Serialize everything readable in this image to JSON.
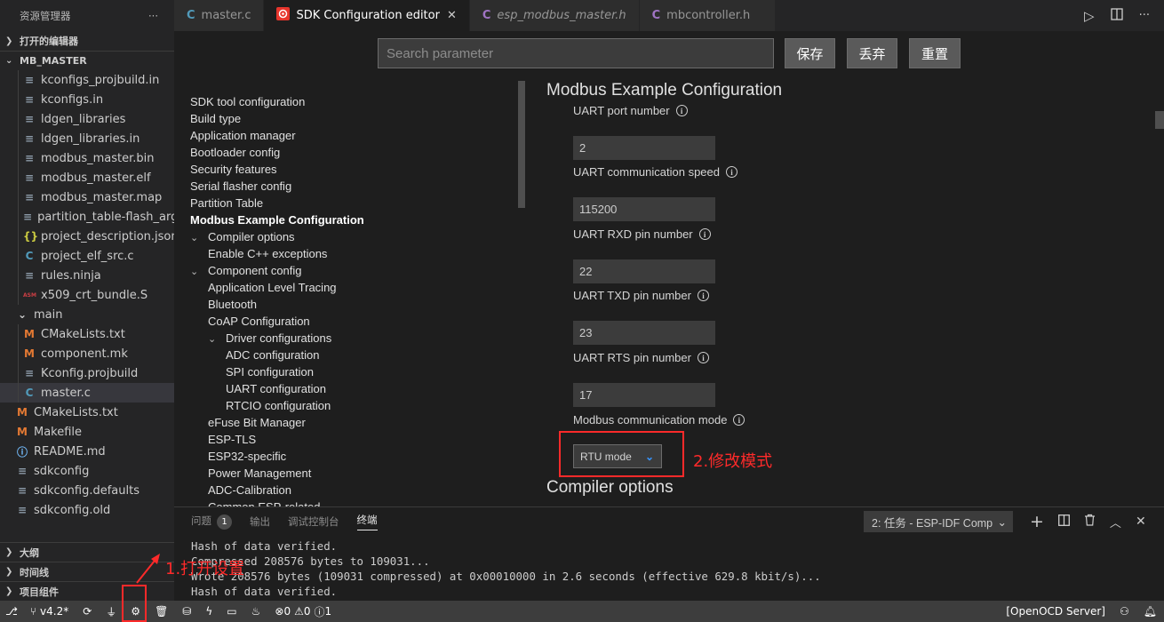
{
  "sidebar": {
    "title": "资源管理器",
    "more": "···",
    "open_editors": "打开的编辑器",
    "project": "MB_MASTER",
    "files": [
      {
        "name": "kconfigs_projbuild.in",
        "icon": "≡",
        "indent": 1
      },
      {
        "name": "kconfigs.in",
        "icon": "≡",
        "indent": 1
      },
      {
        "name": "ldgen_libraries",
        "icon": "≡",
        "indent": 1
      },
      {
        "name": "ldgen_libraries.in",
        "icon": "≡",
        "indent": 1
      },
      {
        "name": "modbus_master.bin",
        "icon": "≡",
        "indent": 1
      },
      {
        "name": "modbus_master.elf",
        "icon": "≡",
        "indent": 1
      },
      {
        "name": "modbus_master.map",
        "icon": "≡",
        "indent": 1
      },
      {
        "name": "partition_table-flash_args",
        "icon": "≡",
        "indent": 1
      },
      {
        "name": "project_description.json",
        "icon": "{}",
        "indent": 1
      },
      {
        "name": "project_elf_src.c",
        "icon": "C",
        "indent": 1
      },
      {
        "name": "rules.ninja",
        "icon": "≡",
        "indent": 1
      },
      {
        "name": "x509_crt_bundle.S",
        "icon": "ASM",
        "indent": 1
      },
      {
        "name": "main",
        "icon": "⌄",
        "indent": 0
      },
      {
        "name": "CMakeLists.txt",
        "icon": "M",
        "indent": 1
      },
      {
        "name": "component.mk",
        "icon": "M",
        "indent": 1
      },
      {
        "name": "Kconfig.projbuild",
        "icon": "≡",
        "indent": 1
      },
      {
        "name": "master.c",
        "icon": "C",
        "indent": 1
      },
      {
        "name": "CMakeLists.txt",
        "icon": "M",
        "indent": 0
      },
      {
        "name": "Makefile",
        "icon": "M",
        "indent": 0
      },
      {
        "name": "README.md",
        "icon": "ⓘ",
        "indent": 0
      },
      {
        "name": "sdkconfig",
        "icon": "≡",
        "indent": 0
      },
      {
        "name": "sdkconfig.defaults",
        "icon": "≡",
        "indent": 0
      },
      {
        "name": "sdkconfig.old",
        "icon": "≡",
        "indent": 0
      }
    ],
    "bottom_sections": [
      "大纲",
      "时间线",
      "项目组件"
    ]
  },
  "tabs": [
    {
      "label": "master.c",
      "icon": "C",
      "active": false,
      "italic": false
    },
    {
      "label": "SDK Configuration editor",
      "icon": "esp",
      "active": true,
      "italic": false
    },
    {
      "label": "esp_modbus_master.h",
      "icon": "C",
      "active": false,
      "italic": true
    },
    {
      "label": "mbcontroller.h",
      "icon": "C",
      "active": false,
      "italic": false
    }
  ],
  "editor": {
    "search_placeholder": "Search parameter",
    "save": "保存",
    "discard": "丢弃",
    "reset": "重置",
    "nav": [
      {
        "label": "SDK tool configuration",
        "level": 0,
        "bold": false,
        "chev": ""
      },
      {
        "label": "Build type",
        "level": 0,
        "bold": false,
        "chev": ""
      },
      {
        "label": "Application manager",
        "level": 0,
        "bold": false,
        "chev": ""
      },
      {
        "label": "Bootloader config",
        "level": 0,
        "bold": false,
        "chev": ""
      },
      {
        "label": "Security features",
        "level": 0,
        "bold": false,
        "chev": ""
      },
      {
        "label": "Serial flasher config",
        "level": 0,
        "bold": false,
        "chev": ""
      },
      {
        "label": "Partition Table",
        "level": 0,
        "bold": false,
        "chev": ""
      },
      {
        "label": "Modbus Example Configuration",
        "level": 0,
        "bold": true,
        "chev": ""
      },
      {
        "label": "Compiler options",
        "level": 0,
        "bold": false,
        "chev": "⌄"
      },
      {
        "label": "Enable C++ exceptions",
        "level": 1,
        "bold": false,
        "chev": ""
      },
      {
        "label": "Component config",
        "level": 0,
        "bold": false,
        "chev": "⌄"
      },
      {
        "label": "Application Level Tracing",
        "level": 1,
        "bold": false,
        "chev": ""
      },
      {
        "label": "Bluetooth",
        "level": 1,
        "bold": false,
        "chev": ""
      },
      {
        "label": "CoAP Configuration",
        "level": 1,
        "bold": false,
        "chev": ""
      },
      {
        "label": "Driver configurations",
        "level": 1,
        "bold": false,
        "chev": "⌄"
      },
      {
        "label": "ADC configuration",
        "level": 2,
        "bold": false,
        "chev": ""
      },
      {
        "label": "SPI configuration",
        "level": 2,
        "bold": false,
        "chev": ""
      },
      {
        "label": "UART configuration",
        "level": 2,
        "bold": false,
        "chev": ""
      },
      {
        "label": "RTCIO configuration",
        "level": 2,
        "bold": false,
        "chev": ""
      },
      {
        "label": "eFuse Bit Manager",
        "level": 1,
        "bold": false,
        "chev": ""
      },
      {
        "label": "ESP-TLS",
        "level": 1,
        "bold": false,
        "chev": ""
      },
      {
        "label": "ESP32-specific",
        "level": 1,
        "bold": false,
        "chev": ""
      },
      {
        "label": "Power Management",
        "level": 1,
        "bold": false,
        "chev": ""
      },
      {
        "label": "ADC-Calibration",
        "level": 1,
        "bold": false,
        "chev": ""
      },
      {
        "label": "Common ESP-related",
        "level": 1,
        "bold": false,
        "chev": ""
      }
    ],
    "section_title": "Modbus Example Configuration",
    "params": [
      {
        "label": "UART port number",
        "value": "2"
      },
      {
        "label": "UART communication speed",
        "value": "115200"
      },
      {
        "label": "UART RXD pin number",
        "value": "22"
      },
      {
        "label": "UART TXD pin number",
        "value": "23"
      },
      {
        "label": "UART RTS pin number",
        "value": "17"
      }
    ],
    "mode_label": "Modbus communication mode",
    "mode_value": "RTU mode",
    "annotation_mode": "2.修改模式",
    "next_section": "Compiler options"
  },
  "panel": {
    "tabs": [
      "问题",
      "输出",
      "调试控制台",
      "终端"
    ],
    "problems_count": "1",
    "terminal_name": "2: 任务 - ESP-IDF Comp",
    "lines": [
      "Hash of data verified.",
      "Compressed 208576 bytes to 109031...",
      "Wrote 208576 bytes (109031 compressed) at 0x00010000 in 2.6 seconds (effective 629.8 kbit/s)...",
      "Hash of data verified."
    ]
  },
  "annotation_settings": "1.打开设置",
  "statusbar": {
    "branch": "v4.2*",
    "errors": "0",
    "warnings": "0",
    "info": "1",
    "openocd": "[OpenOCD Server]"
  }
}
